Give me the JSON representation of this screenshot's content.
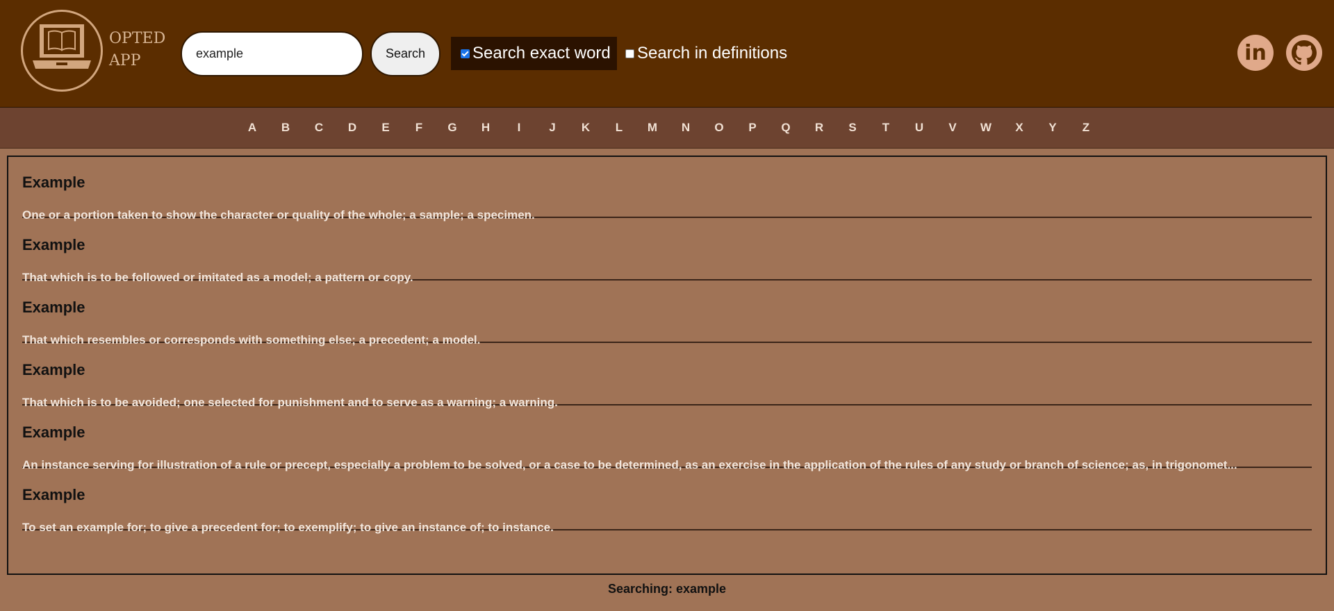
{
  "header": {
    "brand_line1": "OPTED",
    "brand_line2": "APP",
    "search_value": "example",
    "search_button": "Search",
    "checkbox_exact_label": "Search exact word",
    "checkbox_exact_checked": true,
    "checkbox_defs_label": "Search in definitions",
    "checkbox_defs_checked": false,
    "social": [
      {
        "icon": "linkedin-icon",
        "label": "in"
      },
      {
        "icon": "github-icon"
      }
    ]
  },
  "alphabet": [
    "A",
    "B",
    "C",
    "D",
    "E",
    "F",
    "G",
    "H",
    "I",
    "J",
    "K",
    "L",
    "M",
    "N",
    "O",
    "P",
    "Q",
    "R",
    "S",
    "T",
    "U",
    "V",
    "W",
    "X",
    "Y",
    "Z"
  ],
  "results": [
    {
      "word": "Example",
      "definition": "One or a portion taken to show the character or quality of the whole; a sample; a specimen."
    },
    {
      "word": "Example",
      "definition": "That which is to be followed or imitated as a model; a pattern or copy."
    },
    {
      "word": "Example",
      "definition": "That which resembles or corresponds with something else; a precedent; a model."
    },
    {
      "word": "Example",
      "definition": "That which is to be avoided; one selected for punishment and to serve as a warning; a warning."
    },
    {
      "word": "Example",
      "definition": "An instance serving for illustration of a rule or precept, especially a problem to be solved, or a case to be determined, as an exercise in the application of the rules of any study or branch of science; as, in trigonomet..."
    },
    {
      "word": "Example",
      "definition": "To set an example for; to give a precedent for; to exemplify; to give an instance of; to instance."
    }
  ],
  "status": "Searching: example",
  "colors": {
    "header_bg": "#5b2d00",
    "nav_bg": "#6d4330",
    "page_bg": "#a07356",
    "accent": "#e0a98a"
  }
}
